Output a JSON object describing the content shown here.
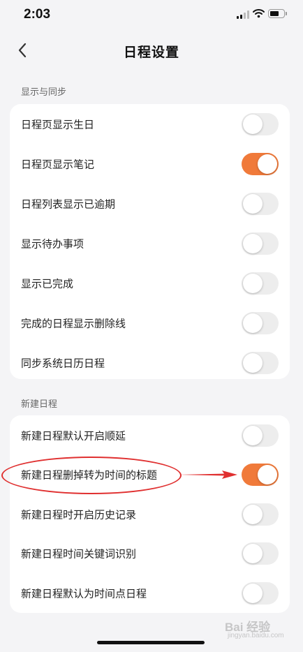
{
  "status_bar": {
    "time": "2:03",
    "icons": [
      "signal-icon",
      "wifi-icon",
      "battery-icon"
    ]
  },
  "nav": {
    "title": "日程设置",
    "back_icon": "chevron-left-icon"
  },
  "sections": [
    {
      "title": "显示与同步",
      "rows": [
        {
          "label": "日程页显示生日",
          "on": false
        },
        {
          "label": "日程页显示笔记",
          "on": true
        },
        {
          "label": "日程列表显示已逾期",
          "on": false
        },
        {
          "label": "显示待办事项",
          "on": false
        },
        {
          "label": "显示已完成",
          "on": false
        },
        {
          "label": "完成的日程显示删除线",
          "on": false
        },
        {
          "label": "同步系统日历日程",
          "on": false
        }
      ]
    },
    {
      "title": "新建日程",
      "rows": [
        {
          "label": "新建日程默认开启顺延",
          "on": false
        },
        {
          "label": "新建日程删掉转为时间的标题",
          "on": true
        },
        {
          "label": "新建日程时开启历史记录",
          "on": false
        },
        {
          "label": "新建日程时间关键词识别",
          "on": false
        },
        {
          "label": "新建日程默认为时间点日程",
          "on": false
        }
      ]
    }
  ],
  "colors": {
    "accent": "#f07a3a",
    "toggle_off": "#ededed",
    "background": "#f4f4f6",
    "annotation": "#e03030"
  },
  "watermark": {
    "text": "Bai 经验",
    "sub": "jingyan.baidu.com"
  }
}
